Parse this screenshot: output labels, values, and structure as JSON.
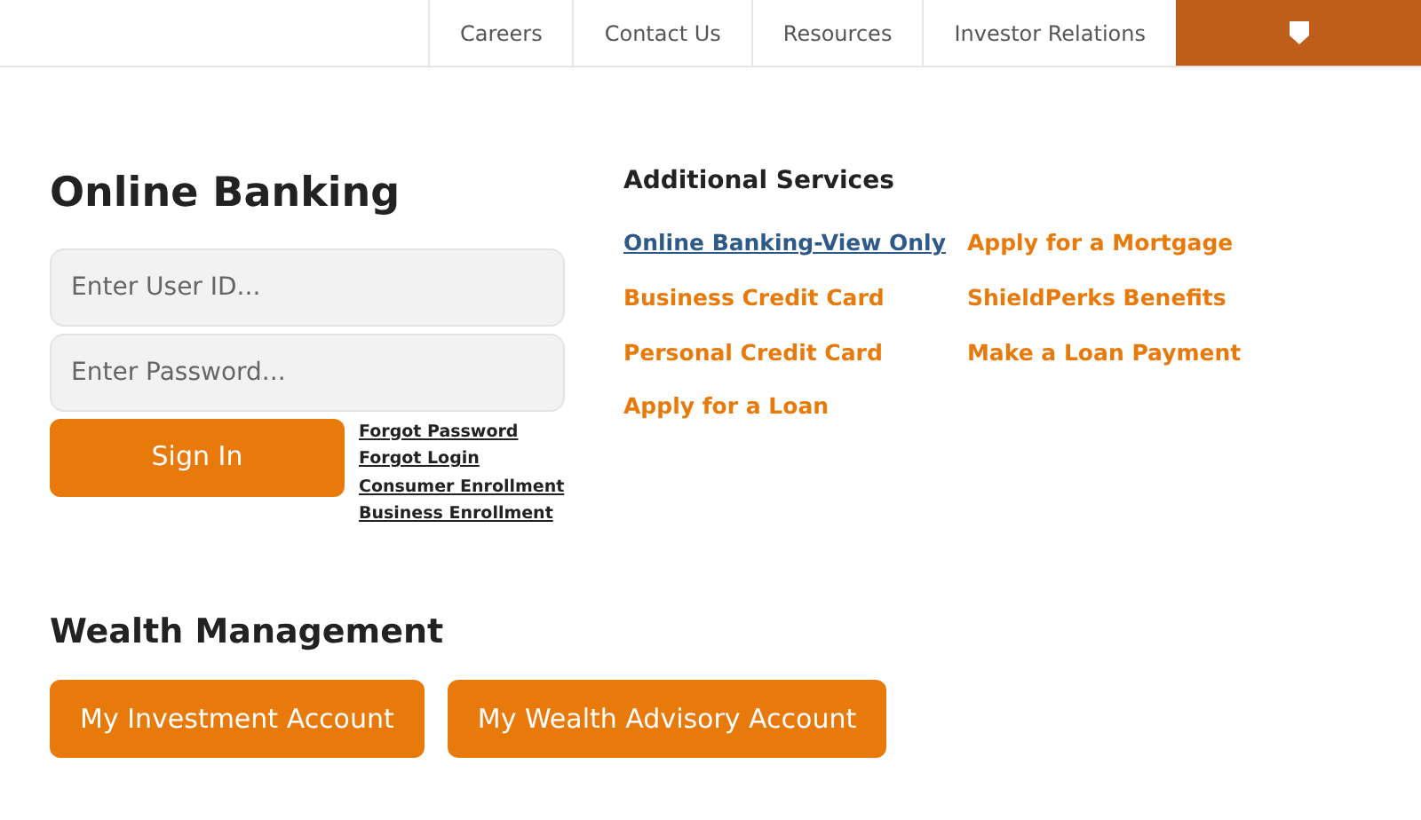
{
  "top_nav": {
    "items": [
      "Careers",
      "Contact Us",
      "Resources",
      "Investor Relations"
    ]
  },
  "online_banking": {
    "title": "Online Banking",
    "user_field": {
      "placeholder": "Enter User ID..."
    },
    "password_field": {
      "placeholder": "Enter Password..."
    },
    "sign_in": "Sign In",
    "links": [
      "Forgot Password",
      "Forgot Login",
      "Consumer Enrollment",
      "Business Enrollment"
    ]
  },
  "additional_services": {
    "title": "Additional Services",
    "links": [
      {
        "label": "Online Banking-View Only",
        "selected": true
      },
      {
        "label": "Apply for a Mortgage",
        "selected": false
      },
      {
        "label": "Business Credit Card",
        "selected": false
      },
      {
        "label": "ShieldPerks Benefits",
        "selected": false
      },
      {
        "label": "Personal Credit Card",
        "selected": false
      },
      {
        "label": "Make a Loan Payment",
        "selected": false
      },
      {
        "label": "Apply for a Loan",
        "selected": false
      }
    ]
  },
  "wealth_management": {
    "title": "Wealth Management",
    "buttons": [
      "My Investment Account",
      "My Wealth Advisory Account"
    ]
  }
}
